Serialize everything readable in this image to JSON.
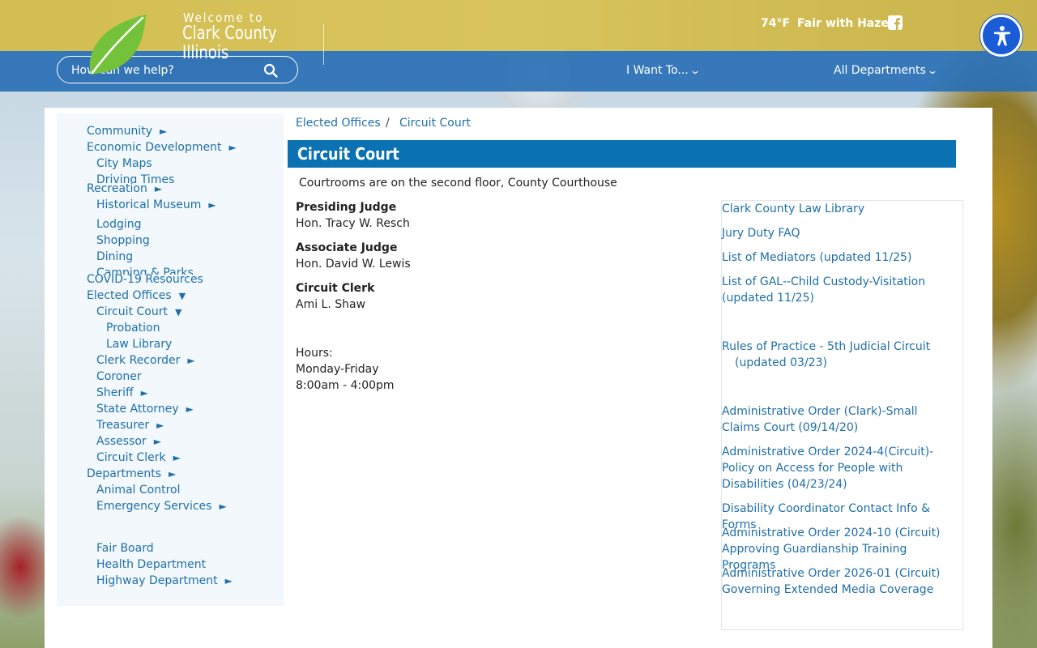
{
  "header": {
    "welcome": "Welcome to",
    "county_line1": "Clark County",
    "county_line2": "Illinois",
    "search_placeholder": "How can we help?",
    "temperature": "74°F",
    "conditions": "Fair with Haze",
    "nav": [
      {
        "label": "I Want To..."
      },
      {
        "label": "All Departments"
      }
    ],
    "icons": {
      "search": "search-icon",
      "facebook": "facebook-icon",
      "accessibility": "accessibility-icon",
      "logo": "leaf-logo"
    },
    "colors": {
      "top_band": "#d2be52",
      "nav_band": "#266eb4",
      "accent_blue": "#0a72b3",
      "link": "#1f6fa8",
      "accessibility": "#1a5bd6",
      "leaf": "#74c23a"
    }
  },
  "sidebar": {
    "community": "Community",
    "economic_development": "Economic Development",
    "city_maps": "City Maps",
    "driving_times": "Driving Times",
    "recreation": "Recreation",
    "historical_museum": "Historical Museum",
    "lodging": "Lodging",
    "shopping": "Shopping",
    "dining": "Dining",
    "camping_parks": "Camping & Parks",
    "covid": "COVID-19 Resources",
    "elected_offices": "Elected Offices",
    "circuit_court": "Circuit Court",
    "probation": "Probation",
    "law_library": "Law Library",
    "clerk_recorder": "Clerk Recorder",
    "coroner": "Coroner",
    "sheriff": "Sheriff",
    "state_attorney": "State Attorney",
    "treasurer": "Treasurer",
    "assessor": "Assessor",
    "circuit_clerk": "Circuit Clerk",
    "departments": "Departments",
    "animal_control": "Animal Control",
    "emergency_services": "Emergency Services",
    "fair_board": "Fair Board",
    "health_department": "Health Department",
    "highway_department": "Highway Department"
  },
  "breadcrumb": {
    "parent": "Elected Offices",
    "separator": "/",
    "current": "Circuit Court"
  },
  "main": {
    "title": "Circuit Court",
    "intro": "Courtrooms are on the second floor, County Courthouse",
    "presiding_label": "Presiding Judge",
    "presiding_name": "Hon. Tracy W. Resch",
    "associate_label": "Associate Judge",
    "associate_name": "Hon. David W. Lewis",
    "clerk_label": "Circuit Clerk",
    "clerk_name": "Ami L. Shaw",
    "hours_label": "Hours:",
    "hours_days": "Monday-Friday",
    "hours_time": "8:00am - 4:00pm"
  },
  "related_links": {
    "law_library": "Clark County Law Library",
    "jury_duty": "Jury Duty FAQ",
    "mediators": "List of Mediators (updated 11/25)",
    "gal": "List of GAL--Child Custody-Visitation (updated 11/25)",
    "rules_line1": "Rules of Practice - 5th Judicial Circuit",
    "rules_line2": "(updated 03/23)",
    "admin_small_claims": "Administrative Order (Clark)-Small Claims Court  (09/14/20)",
    "admin_2024_4": "Administrative Order 2024-4(Circuit)-Policy on Access for People with Disabilities  (04/23/24)",
    "disability_coordinator": "Disability Coordinator Contact Info & Forms",
    "admin_2024_10": "Administrative Order 2024-10 (Circuit) Approving Guardianship Training Programs",
    "admin_2026_01": "Administrative Order 2026-01 (Circuit) Governing Extended Media Coverage"
  }
}
